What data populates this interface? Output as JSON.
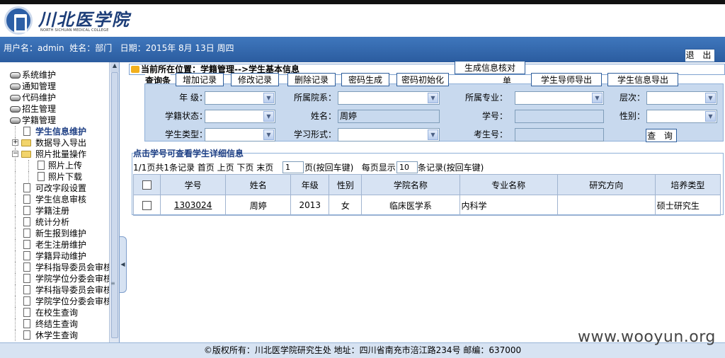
{
  "logo": {
    "cn": "川北医学院",
    "en": "NORTH SICHUAN MEDICAL COLLEGE"
  },
  "userbar": {
    "info": "用户名：admin  姓名：部门   日期：2015年 8月 13日 周四",
    "logout": "退 出"
  },
  "sidebar": {
    "modules": [
      "系统维护",
      "通知管理",
      "代码维护",
      "招生管理",
      "学籍管理"
    ],
    "items": [
      {
        "label": "学生信息维护",
        "type": "doc",
        "level": 1,
        "selected": true
      },
      {
        "label": "数据导入导出",
        "type": "folder",
        "level": 1,
        "expander": "+"
      },
      {
        "label": "照片批量操作",
        "type": "folder",
        "level": 1,
        "expander": "−"
      },
      {
        "label": "照片上传",
        "type": "doc",
        "level": 2
      },
      {
        "label": "照片下载",
        "type": "doc",
        "level": 2
      },
      {
        "label": "可改字段设置",
        "type": "doc",
        "level": 1
      },
      {
        "label": "学生信息审核",
        "type": "doc",
        "level": 1
      },
      {
        "label": "学籍注册",
        "type": "doc",
        "level": 1
      },
      {
        "label": "统计分析",
        "type": "doc",
        "level": 1
      },
      {
        "label": "新生报到维护",
        "type": "doc",
        "level": 1
      },
      {
        "label": "老生注册维护",
        "type": "doc",
        "level": 1
      },
      {
        "label": "学籍异动维护",
        "type": "doc",
        "level": 1
      },
      {
        "label": "学科指导委员会审核",
        "type": "doc",
        "level": 1
      },
      {
        "label": "学院学位分委会审核",
        "type": "doc",
        "level": 1
      },
      {
        "label": "学科指导委员会审核",
        "type": "doc",
        "level": 1
      },
      {
        "label": "学院学位分委会审核",
        "type": "doc",
        "level": 1
      },
      {
        "label": "在校生查询",
        "type": "doc",
        "level": 1
      },
      {
        "label": "终结生查询",
        "type": "doc",
        "level": 1
      },
      {
        "label": "休学生查询",
        "type": "doc",
        "level": 1
      }
    ]
  },
  "location": "当前所在位置：学籍管理-->学生基本信息",
  "toolbar": {
    "legend": "查询条",
    "dan": "单",
    "generate_verify": "生成信息核对",
    "add": "增加记录",
    "edit": "修改记录",
    "delete": "删除记录",
    "pwd_gen": "密码生成",
    "pwd_init": "密码初始化",
    "export_tutor": "学生导师导出",
    "export_student": "学生信息导出"
  },
  "form": {
    "grade": "年  级：",
    "college": "所属院系：",
    "major": "所属专业：",
    "level": "层次：",
    "status": "学籍状态：",
    "name": "姓名：",
    "name_value": "周婷",
    "student_no": "学号：",
    "gender": "性别：",
    "student_type": "学生类型：",
    "study_form": "学习形式：",
    "exam_no": "考生号：",
    "query": "查 询"
  },
  "results": {
    "title": "点击学号可查看学生详细信息",
    "pager_a": "1/1页共1条记录 首页 上页 下页 末页",
    "page_value": "1",
    "pager_b": "页(按回车键)   每页显示",
    "per_page_value": "10",
    "pager_c": "条记录(按回车键)",
    "headers": [
      "学号",
      "姓名",
      "年级",
      "性别",
      "学院名称",
      "专业名称",
      "研究方向",
      "培养类型"
    ],
    "rows": [
      [
        "1303024",
        "周婷",
        "2013",
        "女",
        "临床医学系",
        "内科学",
        "",
        "硕士研究生"
      ]
    ]
  },
  "footer": "©版权所有：川北医学院研究生处 地址：四川省南充市涪江路234号 邮编：637000",
  "watermark": "www.wooyun.org"
}
